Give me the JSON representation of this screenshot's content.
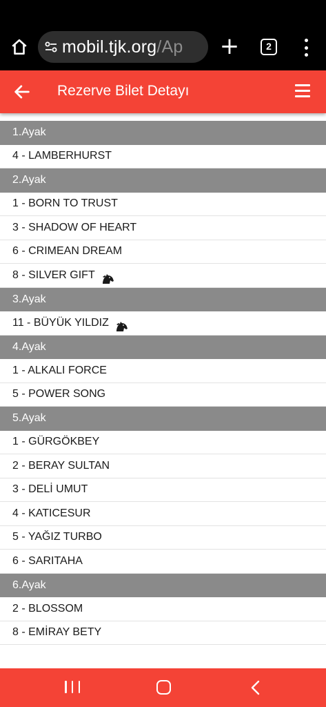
{
  "browser": {
    "url_main": "mobil.tjk.org",
    "url_rest": "/Ap",
    "tab_count": "2",
    "home_icon": "home-icon",
    "site_settings_icon": "site-settings-icon",
    "new_tab_icon": "plus-icon",
    "more_icon": "more-vert-icon"
  },
  "header": {
    "title": "Rezerve Bilet Detayı",
    "back_icon": "arrow-left-icon",
    "menu_icon": "hamburger-menu-icon",
    "color": "#f44336"
  },
  "legs": [
    {
      "label": "1.Ayak",
      "horses": [
        {
          "name": "4 - LAMBERHURST",
          "icon": false
        }
      ]
    },
    {
      "label": "2.Ayak",
      "horses": [
        {
          "name": "1 - BORN TO TRUST",
          "icon": false
        },
        {
          "name": "3 - SHADOW OF HEART",
          "icon": false
        },
        {
          "name": "6 - CRIMEAN DREAM",
          "icon": false
        },
        {
          "name": "8 - SILVER GIFT",
          "icon": true
        }
      ]
    },
    {
      "label": "3.Ayak",
      "horses": [
        {
          "name": "11 - BÜYÜK YILDIZ",
          "icon": true
        }
      ]
    },
    {
      "label": "4.Ayak",
      "horses": [
        {
          "name": "1 - ALKALI FORCE",
          "icon": false
        },
        {
          "name": "5 - POWER SONG",
          "icon": false
        }
      ]
    },
    {
      "label": "5.Ayak",
      "horses": [
        {
          "name": "1 - GÜRGÖKBEY",
          "icon": false
        },
        {
          "name": "2 - BERAY SULTAN",
          "icon": false
        },
        {
          "name": "3 - DELİ UMUT",
          "icon": false
        },
        {
          "name": "4 - KATICESUR",
          "icon": false
        },
        {
          "name": "5 - YAĞIZ TURBO",
          "icon": false
        },
        {
          "name": "6 - SARITAHA",
          "icon": false
        }
      ]
    },
    {
      "label": "6.Ayak",
      "horses": [
        {
          "name": "2 - BLOSSOM",
          "icon": false
        },
        {
          "name": "8 - EMİRAY BETY",
          "icon": false
        }
      ]
    }
  ],
  "horse_icon": "horse-head-icon",
  "nav": {
    "recents_icon": "recent-apps-icon",
    "home_icon": "nav-home-icon",
    "back_icon": "nav-back-icon",
    "color": "#f44336"
  }
}
